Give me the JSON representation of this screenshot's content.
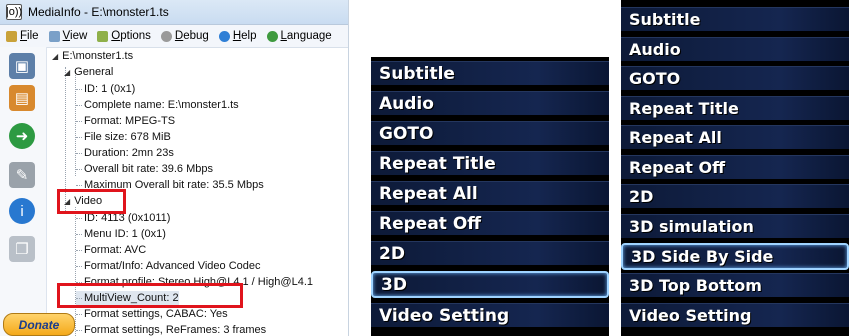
{
  "mediainfo": {
    "title": "MediaInfo - E:\\monster1.ts",
    "app_icon": "|o))",
    "menu": [
      {
        "label": "File",
        "icon": "file-icon",
        "color": "#c9a23a"
      },
      {
        "label": "View",
        "icon": "view-icon",
        "color": "#7aa0c8"
      },
      {
        "label": "Options",
        "icon": "options-icon",
        "color": "#8fb04a"
      },
      {
        "label": "Debug",
        "icon": "debug-icon",
        "color": "#9a9a9a"
      },
      {
        "label": "Help",
        "icon": "help-icon",
        "color": "#2f7fd6"
      },
      {
        "label": "Language",
        "icon": "language-icon",
        "color": "#3f9a3f"
      }
    ],
    "donate": "Donate",
    "tree": {
      "root": "E:\\monster1.ts",
      "general": "General",
      "general_items": [
        "ID: 1 (0x1)",
        "Complete name: E:\\monster1.ts",
        "Format: MPEG-TS",
        "File size: 678 MiB",
        "Duration: 2mn 23s",
        "Overall bit rate: 39.6 Mbps",
        "Maximum Overall bit rate: 35.5 Mbps"
      ],
      "video": "Video",
      "video_items": [
        "ID: 4113 (0x1011)",
        "Menu ID: 1 (0x1)",
        "Format: AVC",
        "Format/Info: Advanced Video Codec",
        "Format profile: Stereo High@L4.1 / High@L4.1",
        "MultiView_Count: 2",
        "Format settings, CABAC: Yes",
        "Format settings, ReFrames: 3 frames"
      ]
    }
  },
  "tv_menu_left": {
    "items": [
      "Subtitle",
      "Audio",
      "GOTO",
      "Repeat Title",
      "Repeat All",
      "Repeat Off",
      "2D",
      "3D",
      "Video Setting"
    ],
    "selected_index": 7,
    "colors": [
      "#ffffff",
      "#ffffff",
      "#ffffff",
      "#ffffff",
      "#ffffff",
      "#ffffff",
      "#ffffff",
      "#ffffff",
      "#ffffff"
    ]
  },
  "tv_menu_right": {
    "items": [
      "Subtitle",
      "Audio",
      "GOTO",
      "Repeat Title",
      "Repeat All",
      "Repeat Off",
      "2D",
      "3D simulation",
      "3D Side By Side",
      "3D Top Bottom",
      "Video Setting"
    ],
    "selected_index": 8
  },
  "highlight_color": "#e0141c"
}
